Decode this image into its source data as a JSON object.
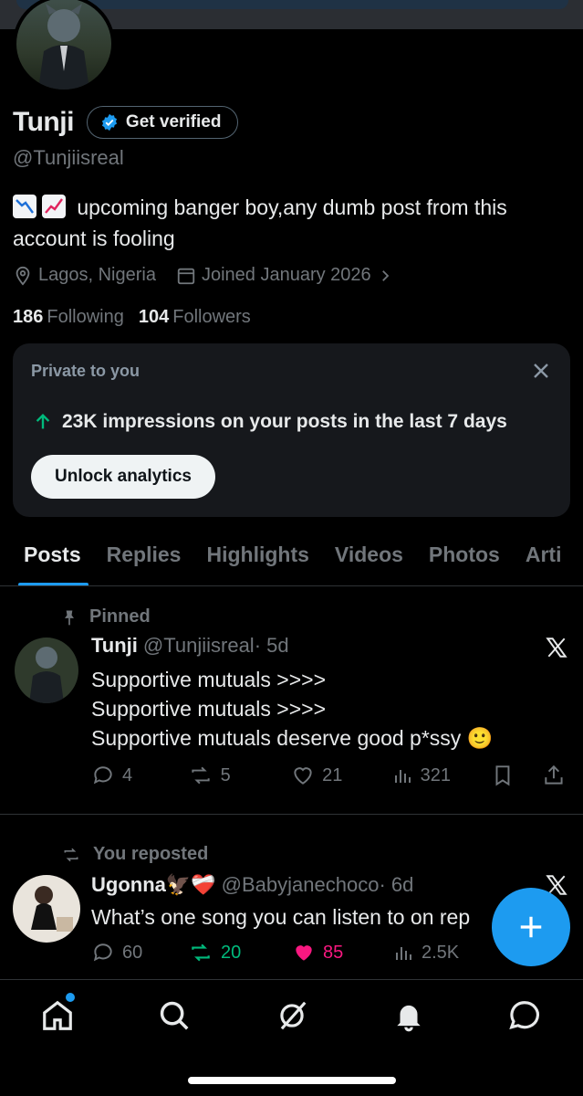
{
  "profile": {
    "name": "Tunji",
    "handle": "@Tunjiisreal",
    "verify_label": "Get verified",
    "bio": "upcoming banger boy,any dumb post from this account is fooling",
    "location": "Lagos, Nigeria",
    "joined": "Joined January 2026",
    "following_count": "186",
    "following_label": "Following",
    "followers_count": "104",
    "followers_label": "Followers"
  },
  "private_card": {
    "title": "Private to you",
    "impressions_text": "23K impressions on your posts in the last 7 days",
    "unlock_label": "Unlock analytics"
  },
  "tabs": [
    {
      "label": "Posts",
      "active": true
    },
    {
      "label": "Replies"
    },
    {
      "label": "Highlights"
    },
    {
      "label": "Videos"
    },
    {
      "label": "Photos"
    },
    {
      "label": "Arti"
    }
  ],
  "posts": [
    {
      "context": "Pinned",
      "name": "Tunji",
      "handle": "@Tunjiisreal",
      "time": "· 5d",
      "lines": [
        "Supportive mutuals >>>>",
        "Supportive mutuals >>>>",
        "Supportive mutuals  deserve good p*ssy 🙂"
      ],
      "replies": "4",
      "reposts": "5",
      "likes": "21",
      "views": "321"
    },
    {
      "context": "You reposted",
      "name": "Ugonna🦅❤️‍🩹",
      "handle": "@Babyjanechoco",
      "time": "· 6d",
      "lines": [
        "What’s one song you can listen to on rep"
      ],
      "replies": "60",
      "reposts": "20",
      "likes": "85",
      "views": "2.5K"
    }
  ],
  "colors": {
    "accent": "#1d9bf0",
    "repost_active": "#00ba7c",
    "like_active": "#f91880",
    "muted": "#71767b"
  }
}
